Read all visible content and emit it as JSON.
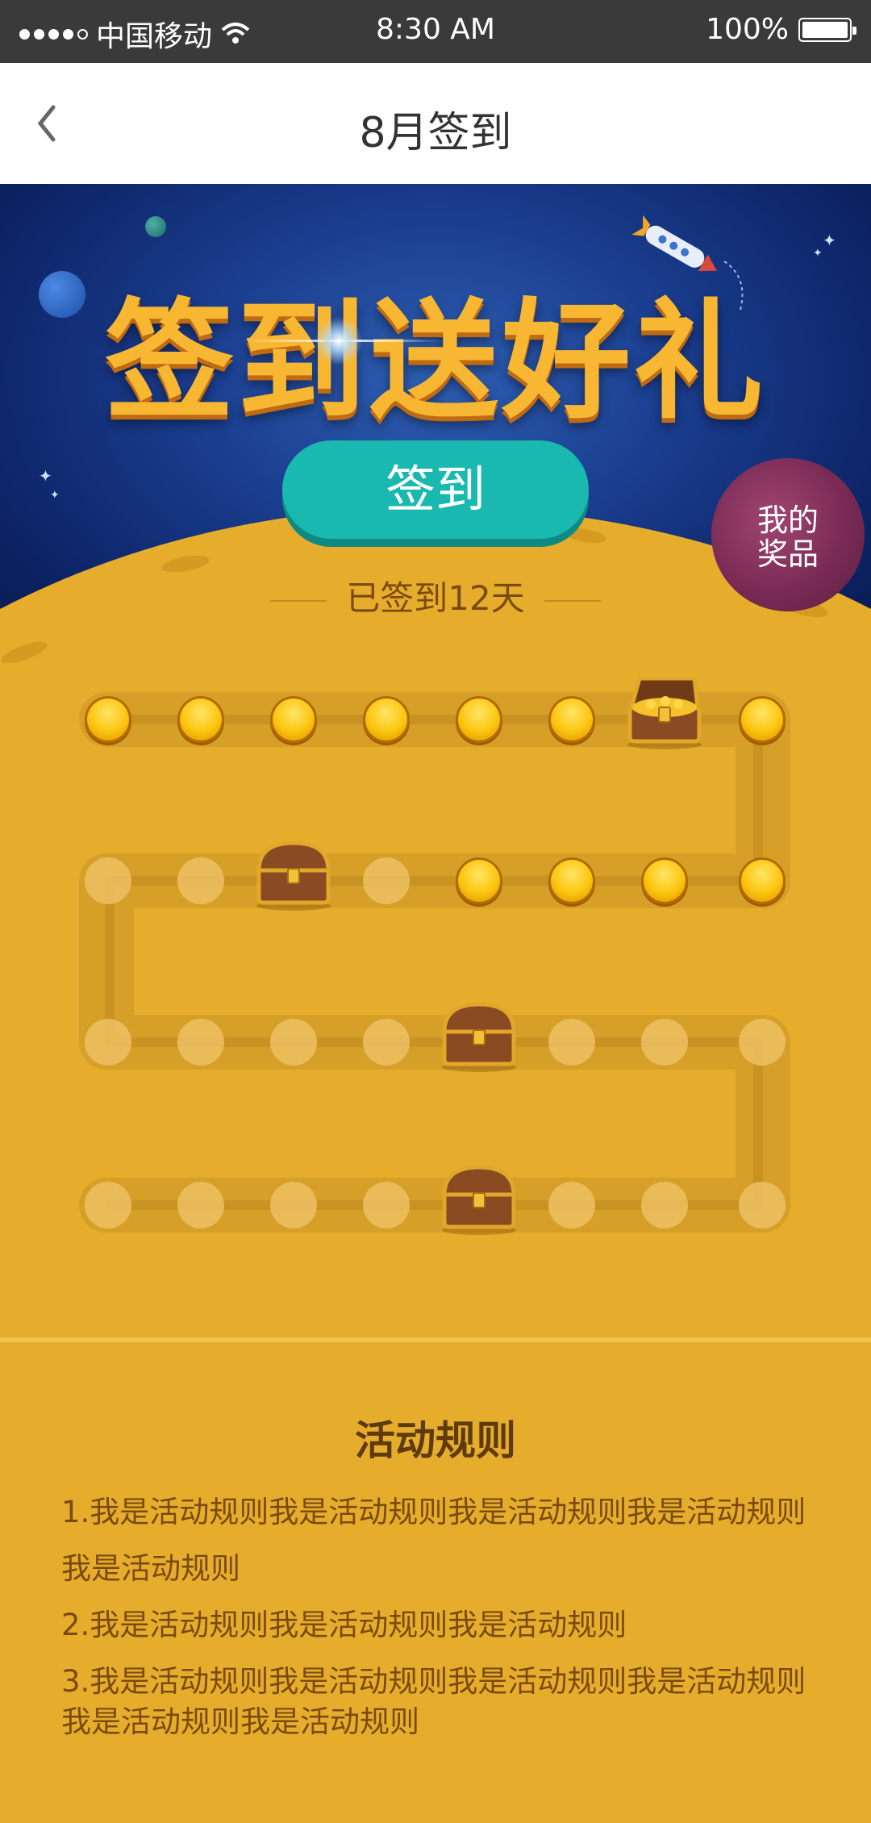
{
  "status_bar": {
    "carrier": "中国移动",
    "time": "8:30 AM",
    "battery": "100%"
  },
  "nav": {
    "title": "8月签到",
    "back_icon": "chevron-left-icon"
  },
  "banner": {
    "headline": "签到送好礼",
    "sign_button": "签到",
    "prize_button": "我的奖品",
    "signed_text": "已签到12天"
  },
  "calendar": {
    "signed_days": 12,
    "rows": [
      [
        "coin",
        "coin",
        "coin",
        "coin",
        "coin",
        "coin",
        "open-chest",
        "coin"
      ],
      [
        "empty",
        "empty",
        "chest",
        "empty",
        "coin",
        "coin",
        "coin",
        "coin"
      ],
      [
        "empty",
        "empty",
        "empty",
        "empty",
        "chest",
        "empty",
        "empty",
        "empty"
      ],
      [
        "empty",
        "empty",
        "empty",
        "empty",
        "chest",
        "empty",
        "empty",
        "empty"
      ]
    ]
  },
  "rules": {
    "title": "活动规则",
    "items": [
      "1.我是活动规则我是活动规则我是活动规则我是活动规则我是活动规则",
      "2.我是活动规则我是活动规则我是活动规则",
      "3.我是活动规则我是活动规则我是活动规则我是活动规则我是活动规则我是活动规则"
    ]
  },
  "colors": {
    "accent_teal": "#1ab9b0",
    "planet_yellow": "#e6ad2c",
    "space_blue": "#1a3d8e"
  }
}
